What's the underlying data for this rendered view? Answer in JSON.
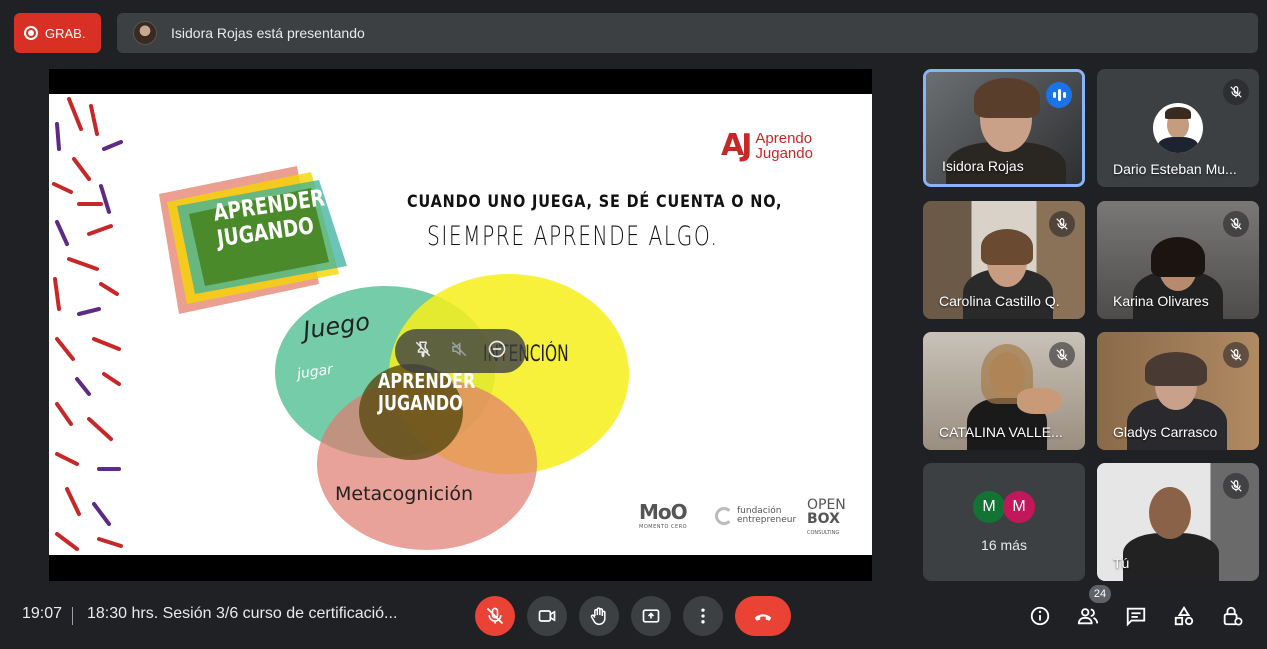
{
  "recording": {
    "label": "GRAB."
  },
  "presenter_bar": {
    "text": "Isidora Rojas está presentando"
  },
  "slide": {
    "quote_line1": "CUANDO UNO JUEGA, SE DÉ CUENTA O NO,",
    "quote_line2": "SIEMPRE APRENDE ALGO.",
    "brand_mark": "AJ",
    "brand_line1": "Aprendo",
    "brand_line2": "Jugando",
    "banner_line1": "APRENDER",
    "banner_line2": "JUGANDO",
    "venn_juego": "Juego",
    "venn_jugar": "jugar",
    "venn_intencion": "INTENCIÓN",
    "venn_center_line1": "APRENDER",
    "venn_center_line2": "JUGANDO",
    "venn_meta": "Metacognición",
    "sponsor_moo": "MoO",
    "sponsor_moo_sub": "MOMENTO CERO",
    "sponsor_fe_line1": "fundación",
    "sponsor_fe_line2": "entrepreneur",
    "sponsor_ob_line1": "OPEN",
    "sponsor_ob_line2": "BOX",
    "sponsor_ob_sub": "CONSULTING"
  },
  "participants": [
    {
      "name": "Isidora Rojas",
      "speaking": true
    },
    {
      "name": "Dario Esteban Mu..."
    },
    {
      "name": "Carolina Castillo Q."
    },
    {
      "name": "Karina Olivares"
    },
    {
      "name": "CATALINA VALLE..."
    },
    {
      "name": "Gladys Carrasco"
    },
    {
      "name": "Tú"
    }
  ],
  "more_participants": {
    "initial_1": "M",
    "initial_2": "M",
    "label": "16 más",
    "color_1": "#137333",
    "color_2": "#c2185b"
  },
  "bottom": {
    "time": "19:07",
    "meeting_title": "18:30 hrs. Sesión 3/6 curso de certificació...",
    "participant_count": "24"
  },
  "colors": {
    "end_call": "#ea4335",
    "mic_off": "#ea4335",
    "active_border": "#8ab4f8"
  },
  "icons": [
    "record-icon",
    "mic-off-icon",
    "camera-icon",
    "raise-hand-icon",
    "present-icon",
    "more-options-icon",
    "end-call-icon",
    "info-icon",
    "people-icon",
    "chat-icon",
    "activities-icon",
    "host-controls-icon",
    "pin-icon",
    "volume-off-icon",
    "remove-icon"
  ]
}
